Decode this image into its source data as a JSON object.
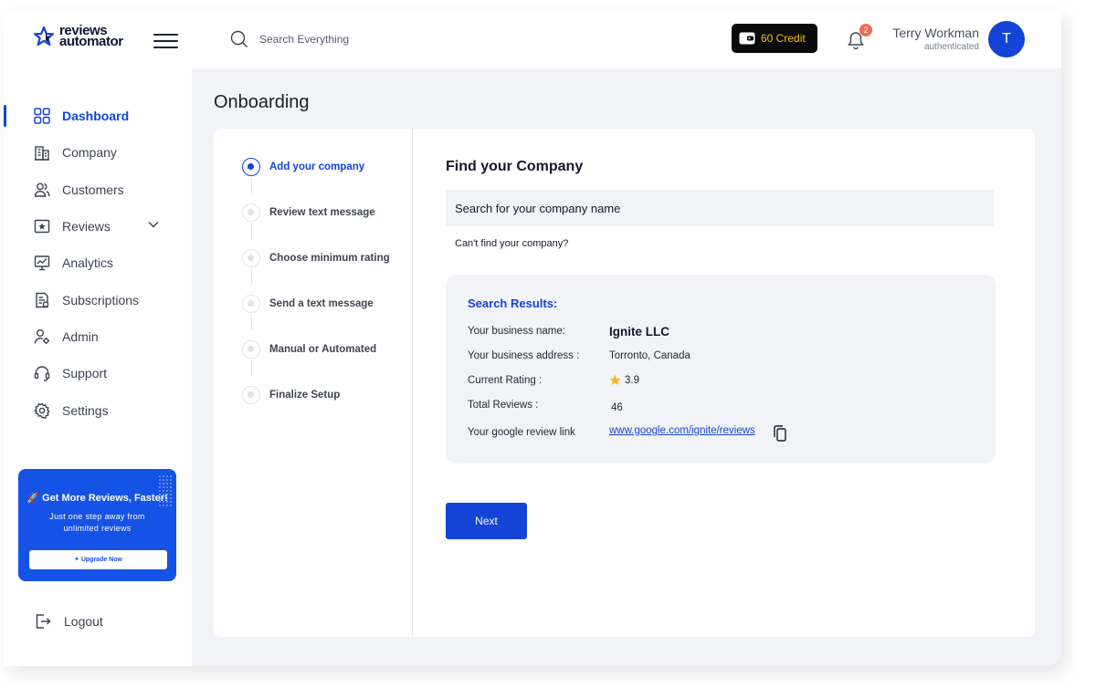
{
  "brand": {
    "line1": "reviews",
    "line2": "automator"
  },
  "sidebar": {
    "items": [
      {
        "label": "Dashboard",
        "icon": "grid-icon"
      },
      {
        "label": "Company",
        "icon": "building-icon"
      },
      {
        "label": "Customers",
        "icon": "users-icon"
      },
      {
        "label": "Reviews",
        "icon": "star-board-icon"
      },
      {
        "label": "Analytics",
        "icon": "chart-icon"
      },
      {
        "label": "Subscriptions",
        "icon": "receipt-icon"
      },
      {
        "label": "Admin",
        "icon": "user-gear-icon"
      },
      {
        "label": "Support",
        "icon": "headset-icon"
      },
      {
        "label": "Settings",
        "icon": "gear-icon"
      }
    ],
    "active": "Dashboard",
    "promo": {
      "title": "🚀 Get More Reviews, Faster!",
      "subtitle": "Just one step away from unlimited reviews",
      "button": "✦ Upgrade Now"
    },
    "logout": "Logout"
  },
  "header": {
    "search_placeholder": "Search Everything",
    "credit": "60 Credit",
    "notifications": "2",
    "user_name": "Terry Workman",
    "user_status": "authenticated",
    "avatar_initial": "T"
  },
  "page": {
    "title": "Onboarding"
  },
  "steps": [
    {
      "label": "Add your company",
      "active": true
    },
    {
      "label": "Review text message",
      "active": false
    },
    {
      "label": "Choose minimum rating",
      "active": false
    },
    {
      "label": "Send a text message",
      "active": false
    },
    {
      "label": "Manual or Automated",
      "active": false
    },
    {
      "label": "Finalize Setup",
      "active": false
    }
  ],
  "find": {
    "title": "Find your Company",
    "search_placeholder": "Search for your company name",
    "cant_find": "Can't find your company?"
  },
  "results": {
    "title": "Search Results:",
    "rows": [
      {
        "label": "Your business name:",
        "value": "Ignite LLC"
      },
      {
        "label": "Your business address :",
        "value": "Torronto, Canada"
      },
      {
        "label": "Current Rating :",
        "value": "3.9"
      },
      {
        "label": "Total Reviews :",
        "value": "46"
      },
      {
        "label": "Your google review link",
        "value": "www.google.com/ignite/reviews"
      }
    ]
  },
  "actions": {
    "next": "Next"
  },
  "colors": {
    "accent": "#1443d8",
    "credit_text": "#f0c417",
    "badge": "#f26b4c",
    "star": "#f5b82e"
  }
}
